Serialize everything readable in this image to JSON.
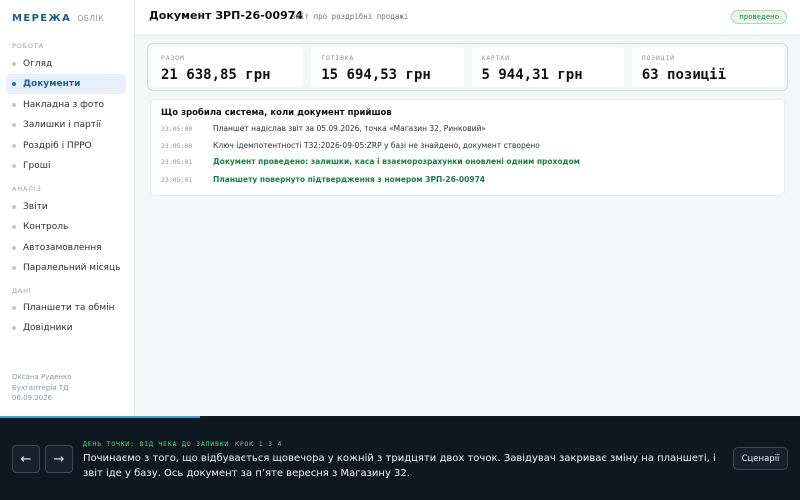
{
  "app": {
    "brand": "МЕРЕЖА",
    "brand_sub": "ОБЛІК"
  },
  "sidebar": {
    "sections": [
      {
        "label": "РОБОТА",
        "items": [
          "Огляд",
          "Документи",
          "Накладна з фото",
          "Залишки і партії",
          "Роздріб і ПРРО",
          "Гроші"
        ]
      },
      {
        "label": "АНАЛІЗ",
        "items": [
          "Звіти",
          "Контроль",
          "Автозамовлення",
          "Паралельний місяць"
        ]
      },
      {
        "label": "ДАНІ",
        "items": [
          "Планшети та обмін",
          "Довідники"
        ]
      }
    ],
    "active_item": "Документи",
    "user": {
      "name": "Оксана Руденко",
      "role": "Бухгалтерія ТД",
      "date": "06.09.2026"
    }
  },
  "header": {
    "title": "Документ ЗРП-26-00974",
    "subtitle": "звіт про роздрібні продажі",
    "status": "проведено"
  },
  "stats": [
    {
      "label": "РАЗОМ",
      "value": "21 638,85 грн"
    },
    {
      "label": "ГОТІВКА",
      "value": "15 694,53 грн"
    },
    {
      "label": "КАРТКИ",
      "value": "5 944,31 грн"
    },
    {
      "label": "ПОЗИЦІЙ",
      "value": "63 позиції"
    }
  ],
  "log": {
    "title": "Що зробила система, коли документ прийшов",
    "rows": [
      {
        "time": "23:05:00",
        "text": "Планшет надіслав звіт за 05.09.2026, точка «Магазин 32, Ринковий»",
        "ok": false
      },
      {
        "time": "23:05:00",
        "text": "Ключ ідемпотентності T32:2026-09-05:ZRP у базі не знайдено, документ створено",
        "ok": false
      },
      {
        "time": "23:05:01",
        "text": "Документ проведено: залишки, каса і взаєморозрахунки оновлені одним проходом",
        "ok": true
      },
      {
        "time": "23:05:01",
        "text": "Планшету повернуто підтвердження з номером ЗРП-26-00974",
        "ok": true
      }
    ]
  },
  "narrator": {
    "progress": 0.25,
    "scene_title": "ДЕНЬ ТОЧКИ: ВІД ЧЕКА ДО ЗАЛИВКИ",
    "step_text": "КРОК 1 З 4",
    "text": "Починаємо з того, що відбувається щовечора у кожній з тридцяти двох точок. Завідувач закриває зміну на планшеті, і звіт іде у базу. Ось документ за п’яте вересня з Магазину 32.",
    "prev_label": "←",
    "next_label": "→",
    "scenarios_label": "Сценарії"
  },
  "colors": {
    "accent": "#1b6ec2",
    "success": "#1e7d45",
    "narrator_bg": "#0f1821",
    "progress": "#3fa7c9"
  }
}
